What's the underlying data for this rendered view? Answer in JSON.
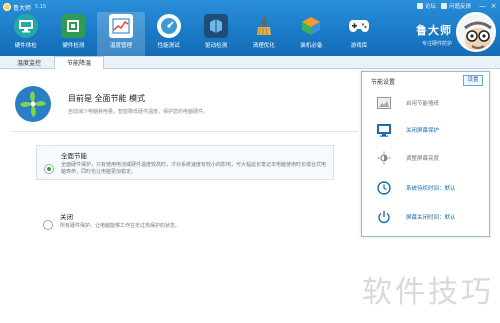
{
  "window": {
    "title": "鲁大师",
    "version": "5.15"
  },
  "top_links": [
    "论坛",
    "问题反馈"
  ],
  "window_controls": [
    "—",
    "×"
  ],
  "nav": [
    {
      "label": "硬件体检",
      "icon": "hardware-check-icon",
      "color": "#24a3a0"
    },
    {
      "label": "硬件检测",
      "icon": "hardware-detect-icon",
      "color": "#2b8c4d"
    },
    {
      "label": "温度管理",
      "icon": "temperature-icon",
      "color": "#ffffff"
    },
    {
      "label": "性能测试",
      "icon": "performance-icon",
      "color": "#3b9ad8"
    },
    {
      "label": "驱动检测",
      "icon": "driver-icon",
      "color": "#2f6fa9"
    },
    {
      "label": "清理优化",
      "icon": "broom-icon",
      "color": "#1f6bb0"
    },
    {
      "label": "装机必备",
      "icon": "install-icon",
      "color": "#2a80c8"
    },
    {
      "label": "游戏库",
      "icon": "gamepad-icon",
      "color": "#2a80c8"
    }
  ],
  "brand": {
    "name": "鲁大师",
    "slogan": "专注硬件防护"
  },
  "tabs": [
    "温度监控",
    "节能降温"
  ],
  "main": {
    "mode_title": "目前是 全面节能 模式",
    "mode_desc": "自动减少电脑耗电量，智能降低硬件温度，保护您的电脑硬件。",
    "options": [
      {
        "title": "全面节能",
        "desc": "全面硬件保护，只有使用电池或硬件温度较高时，才对系统速度有较小的影响，可大幅延长笔记本电脑使用时长或台式电脑寿命，同时也让电脑更加稳定。",
        "selected": true
      },
      {
        "title": "关闭",
        "desc": "所有硬件保护，让电脑能够工作在无过热保护的状态。",
        "selected": false
      }
    ]
  },
  "panel": {
    "title": "节能设置",
    "button": "设置",
    "items": [
      {
        "label": "启用节能墙纸",
        "icon": "wallpaper-icon",
        "muted": true
      },
      {
        "label": "关闭屏幕保护",
        "icon": "monitor-icon",
        "muted": false
      },
      {
        "label": "调整屏幕亮度",
        "icon": "brightness-icon",
        "muted": true
      },
      {
        "label": "系统待机时间：默认",
        "icon": "standby-clock-icon",
        "muted": false
      },
      {
        "label": "屏幕关闭时间：默认",
        "icon": "power-icon",
        "muted": false
      }
    ]
  },
  "watermark": "软件技巧",
  "colors": {
    "header": "#1a79c6",
    "accent": "#1b6cb3",
    "radio_on": "#3a9b3a"
  }
}
